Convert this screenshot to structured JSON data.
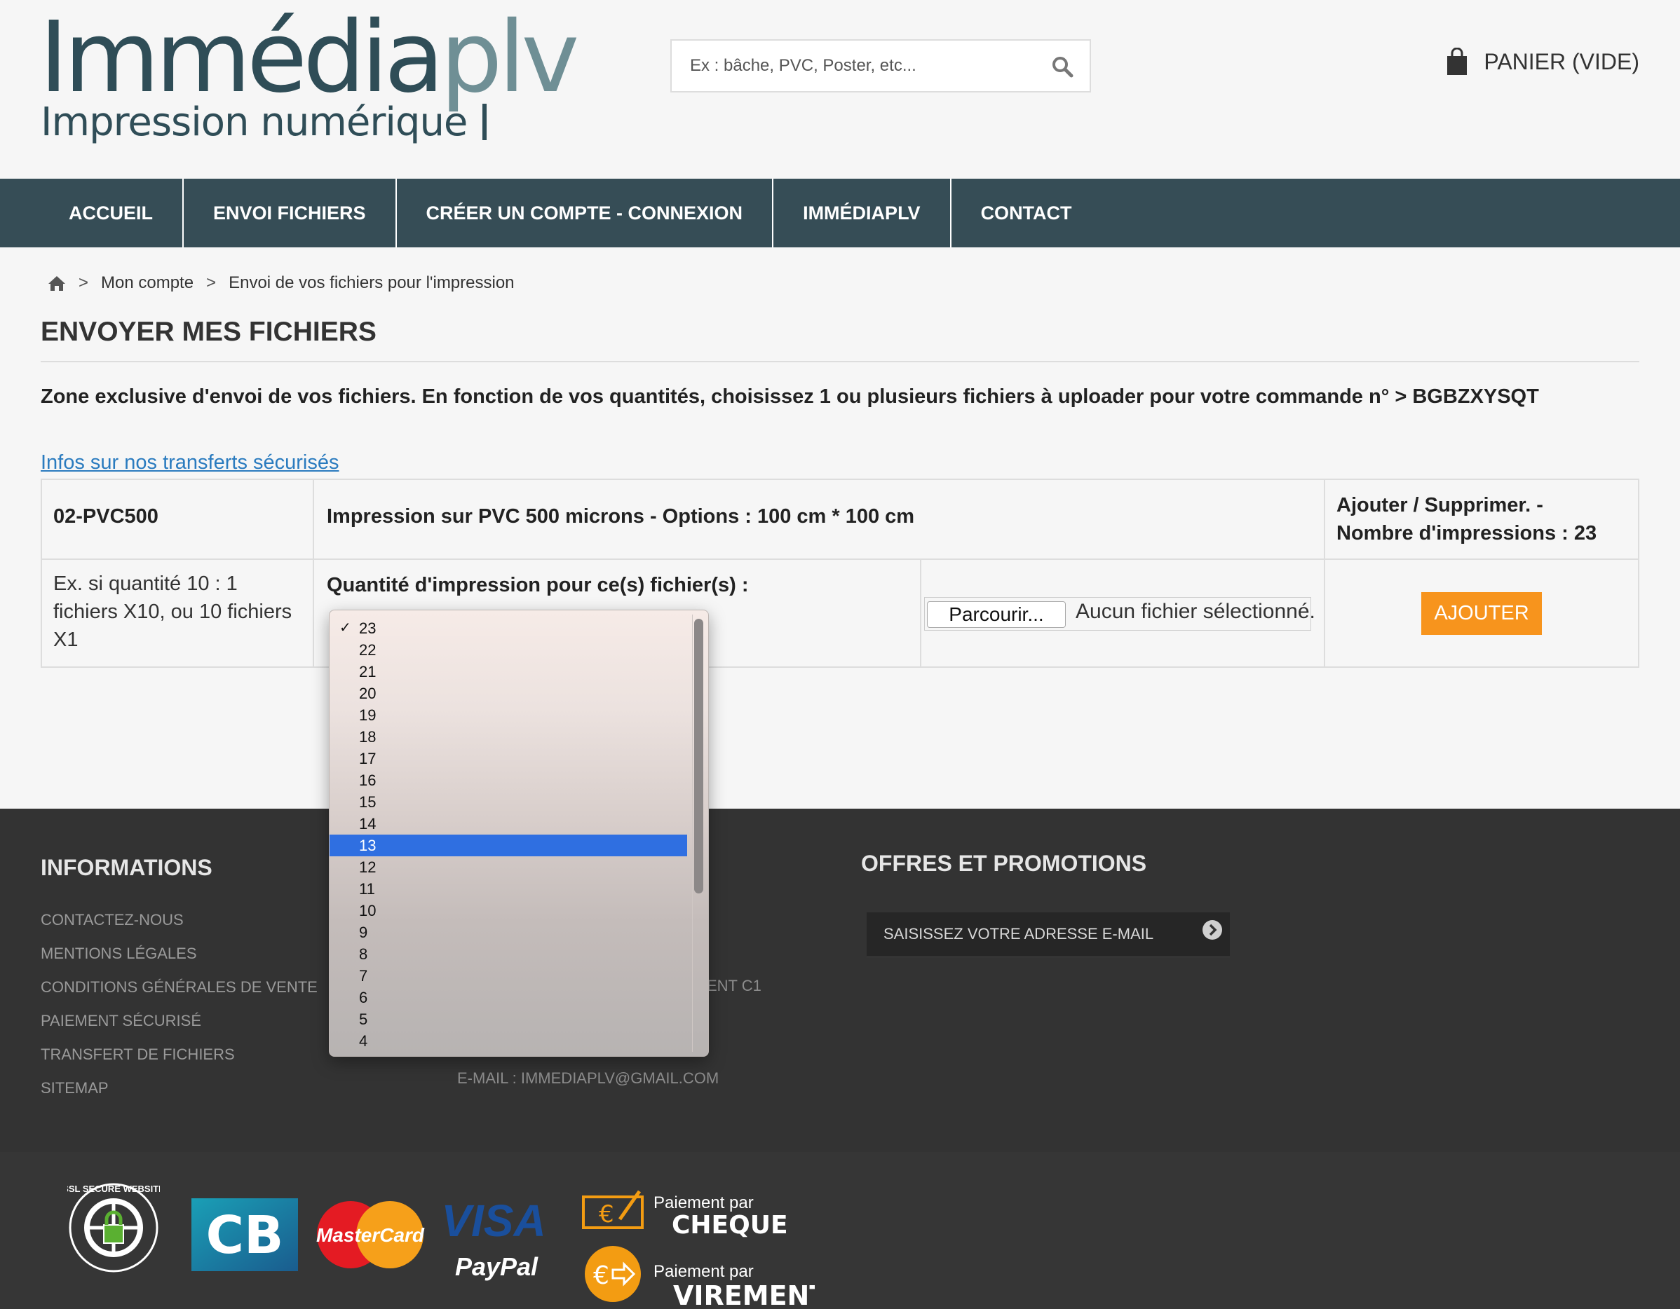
{
  "header": {
    "logo_main": "Immédia",
    "logo_accent": "plv",
    "logo_tagline": "Impression numérique",
    "search_placeholder": "Ex : bâche, PVC, Poster, etc...",
    "cart_label": "PANIER (VIDE)"
  },
  "nav": {
    "items": [
      {
        "label": "ACCUEIL"
      },
      {
        "label": "ENVOI FICHIERS"
      },
      {
        "label": "CRÉER UN COMPTE - CONNEXION"
      },
      {
        "label": "IMMÉDIAPLV"
      },
      {
        "label": "CONTACT"
      }
    ]
  },
  "breadcrumb": {
    "sep": ">",
    "items": [
      "Mon compte",
      "Envoi de vos fichiers pour l'impression"
    ]
  },
  "page": {
    "title": "ENVOYER MES FICHIERS",
    "intro": "Zone exclusive d'envoi de vos fichiers. En fonction de vos quantités, choisissez 1 ou plusieurs fichiers à uploader pour votre commande n° > BGBZXYSQT",
    "info_link": "Infos sur nos transferts sécurisés"
  },
  "table": {
    "ref": "02-PVC500",
    "product": "Impression sur PVC 500 microns - Options : 100 cm * 100 cm",
    "action_header_line1": "Ajouter / Supprimer. -",
    "action_header_line2": "Nombre d'impressions : 23",
    "example_line1": "Ex. si quantité 10 : 1",
    "example_line2": "fichiers X10, ou 10 fichiers",
    "example_line3": "X1",
    "quantity_label": "Quantité d'impression pour ce(s) fichier(s) :",
    "browse_label": "Parcourir...",
    "file_status": "Aucun fichier sélectionné.",
    "add_label": "AJOUTER"
  },
  "dropdown": {
    "checked_value": "23",
    "highlighted_value": "13",
    "options": [
      "23",
      "22",
      "21",
      "20",
      "19",
      "18",
      "17",
      "16",
      "15",
      "14",
      "13",
      "12",
      "11",
      "10",
      "9",
      "8",
      "7",
      "6",
      "5",
      "4"
    ]
  },
  "footer": {
    "informations_title": "INFORMATIONS",
    "links": [
      "CONTACTEZ-NOUS",
      "MENTIONS LÉGALES",
      "CONDITIONS GÉNÉRALES DE VENTE",
      "PAIEMENT SÉCURISÉ",
      "TRANSFERT DE FICHIERS",
      "SITEMAP"
    ],
    "contact_partial": "ENT C1",
    "email": "E-MAIL : IMMEDIAPLV@GMAIL.COM",
    "offers_title": "OFFRES ET PROMOTIONS",
    "newsletter_placeholder": "SAISISSEZ VOTRE ADRESSE E-MAIL"
  },
  "payments": {
    "ssl_text": "SSL SECURE WEBSITE",
    "cb": "CB",
    "mastercard": "MasterCard",
    "visa": "VISA",
    "paypal": "PayPal",
    "cheque_prefix": "Paiement par",
    "cheque": "CHEQUE",
    "virement_prefix": "Paiement par",
    "virement": "VIREMENT"
  },
  "colors": {
    "nav_bg": "#364d56",
    "accent_button": "#f7941d",
    "link": "#2a7bbf",
    "selection": "#2f6fe1"
  }
}
